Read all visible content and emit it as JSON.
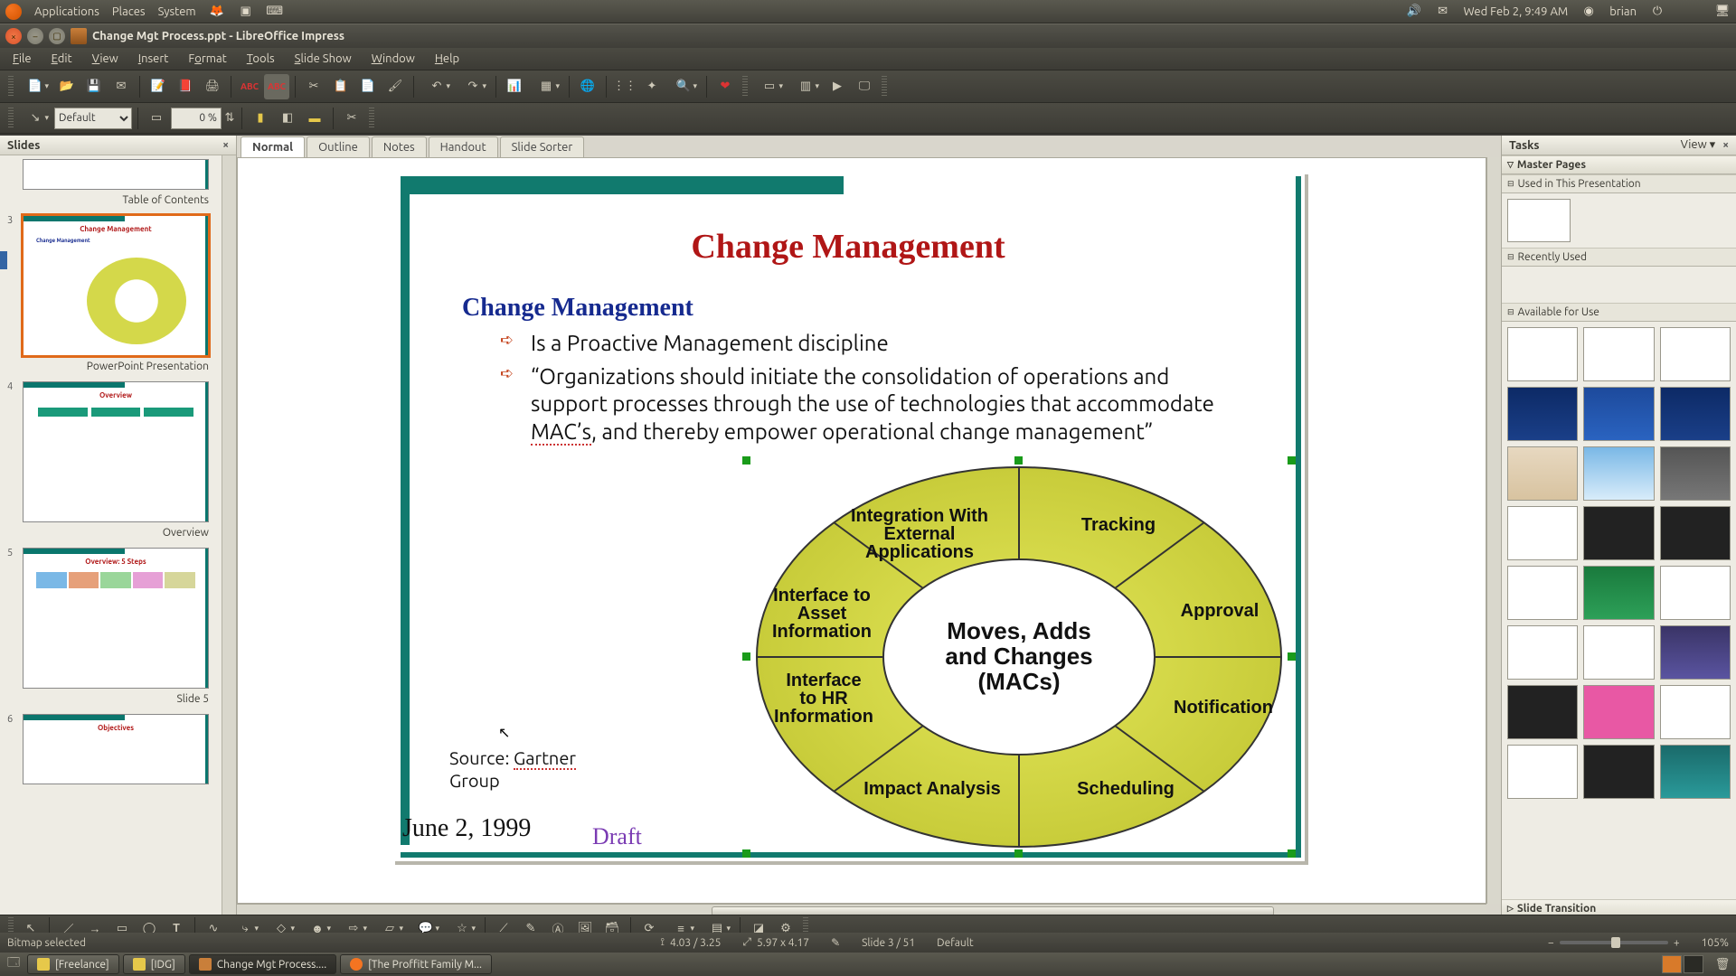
{
  "gnome": {
    "apps": "Applications",
    "places": "Places",
    "system": "System",
    "clock": "Wed Feb  2,  9:49 AM",
    "user": "brian"
  },
  "window": {
    "title": "Change Mgt Process.ppt - LibreOffice Impress"
  },
  "menus": [
    "File",
    "Edit",
    "View",
    "Insert",
    "Format",
    "Tools",
    "Slide Show",
    "Window",
    "Help"
  ],
  "toolbar2": {
    "style": "Default",
    "zoom": "0 %"
  },
  "panels": {
    "slides": "Slides",
    "tasks": "Tasks",
    "tasks_view": "View",
    "master": "Master Pages",
    "used": "Used in This Presentation",
    "recent": "Recently Used",
    "avail": "Available for Use",
    "transition": "Slide Transition"
  },
  "view_tabs": [
    "Normal",
    "Outline",
    "Notes",
    "Handout",
    "Slide Sorter"
  ],
  "thumbs": [
    {
      "num": "",
      "cap": "Table of Contents"
    },
    {
      "num": "3",
      "cap": "PowerPoint Presentation",
      "sel": true
    },
    {
      "num": "4",
      "cap": "Overview"
    },
    {
      "num": "5",
      "cap": "Slide 5"
    },
    {
      "num": "6",
      "cap": ""
    }
  ],
  "slide": {
    "title": "Change Management",
    "subtitle": "Change Management",
    "b1": "Is a Proactive Management discipline",
    "b2a": "“Organizations should initiate the consolidation of operations and support processes through the use of technologies that accommodate ",
    "b2b": "MAC’s",
    "b2c": ", and thereby empower operational change management”",
    "src1": "Source: ",
    "src2": "Gartner",
    "src3": "Group",
    "date": "June 2, 1999",
    "draft": "Draft",
    "center1": "Moves, Adds",
    "center2": "and Changes",
    "center3": "(MACs)",
    "seg": {
      "int": "Integration With\nExternal\nApplications",
      "trk": "Tracking",
      "app": "Approval",
      "not": "Notification",
      "sch": "Scheduling",
      "imp": "Impact Analysis",
      "hr": "Interface\nto HR\nInformation",
      "asset": "Interface to\nAsset\nInformation"
    }
  },
  "status": {
    "sel": "Bitmap selected",
    "pos": "4.03 / 3.25",
    "size": "5.97 x 4.17",
    "slide": "Slide 3 / 51",
    "master": "Default",
    "zoom": "105%"
  },
  "taskbar": {
    "t1": "[Freelance]",
    "t2": "[IDG]",
    "t3": "Change Mgt Process....",
    "t4": "[The Proffitt Family M..."
  }
}
